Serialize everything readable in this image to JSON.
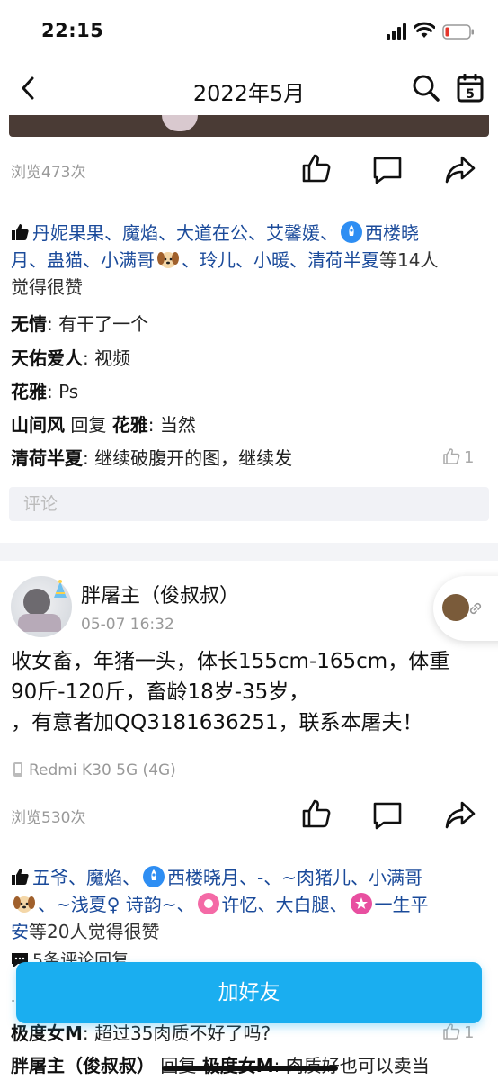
{
  "status_bar": {
    "time": "22:15",
    "icons": [
      "signal-icon",
      "wifi-icon",
      "battery-icon"
    ],
    "battery_color": "#e5352b"
  },
  "nav": {
    "title": "2022年5月",
    "icons": [
      "back-icon",
      "search-icon",
      "calendar-icon"
    ]
  },
  "post1": {
    "views": "浏览473次",
    "actions": [
      "like-icon",
      "comment-icon",
      "share-icon"
    ],
    "likes": {
      "names_line1": "丹妮果果、魔焰、大道在公、艾馨媛、",
      "names_line1b": "西楼晓",
      "names_line2a": "月、蛊猫、小满哥",
      "names_line2b": "、玲儿、小暖、清荷半夏",
      "names_line2c": "等14人",
      "names_line3": "觉得很赞"
    },
    "comments": [
      {
        "author": "无情",
        "text": ": 有干了一个"
      },
      {
        "author": "天佑爱人",
        "text": ": 视频"
      },
      {
        "author": "花雅",
        "text": ": Ps"
      },
      {
        "author": "山间风",
        "reply_word": " 回复 ",
        "reply_to": "花雅",
        "text": ": 当然"
      },
      {
        "author": "清荷半夏",
        "text": ": 继续破腹开的图，继续发",
        "likes": "1"
      }
    ],
    "comment_placeholder": "评论"
  },
  "post2": {
    "poster_name": "胖屠主（俊叔叔）",
    "time": "05-07 16:32",
    "body_lines": [
      "收女畜，年猪一头，体长155cm-165cm，体重",
      "90斤-120斤，畜龄18岁-35岁，",
      "，有意者加QQ3181636251，联系本屠夫！"
    ],
    "device": "Redmi K30 5G (4G)",
    "views": "浏览530次",
    "actions": [
      "like-icon",
      "comment-icon",
      "share-icon"
    ],
    "likes": {
      "line1a": "五爷、魔焰、",
      "line1b": "西楼晓月、-、~肉猪儿、小满哥",
      "line2a": "、~浅夏♀ 诗韵~、",
      "line2b": "许忆、大白腿、",
      "line2c": "一生平",
      "line3a": "安",
      "line3b": "等20人觉得很赞"
    },
    "comment_count": "5条评论回复",
    "dots": "...",
    "comments": [
      {
        "author": "极度女M",
        "text": ": 超过35肉质不好了吗?",
        "likes": "1"
      },
      {
        "author": "胖屠主（俊叔叔）",
        "reply_word": " 回复 ",
        "reply_to": "极度女M",
        "text": ": 肉质好也可以卖当"
      }
    ]
  },
  "add_friend_button": "加好友",
  "accent_color": "#1aaef0",
  "link_color": "#1a4a9a"
}
